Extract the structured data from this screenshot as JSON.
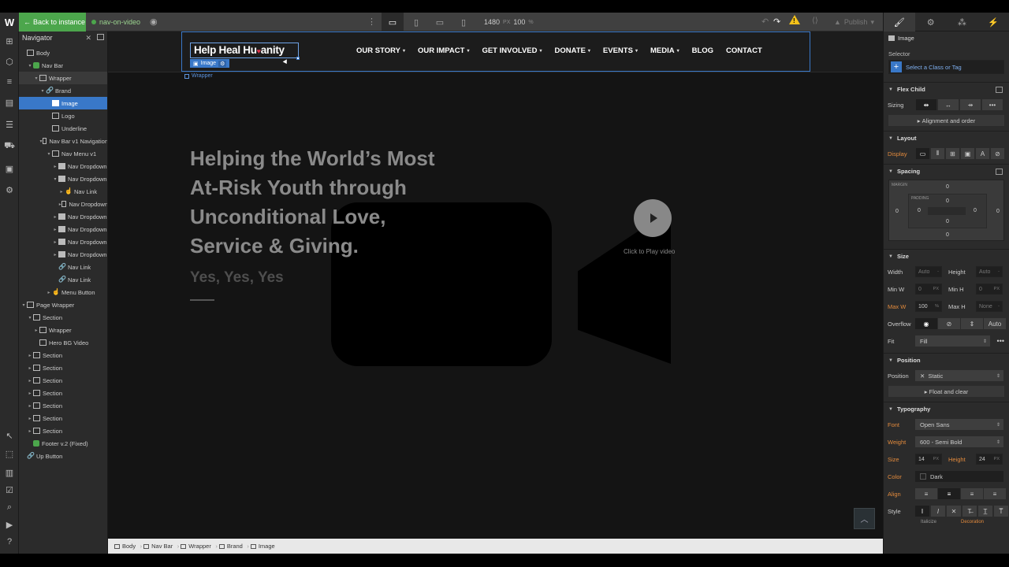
{
  "topbar": {
    "back_label": "Back to instance",
    "env_name": "nav-on-video",
    "canvas_width": "1480",
    "width_unit": "PX",
    "zoom": "100",
    "zoom_unit": "%",
    "publish_label": "Publish",
    "warning_color": "#f3c11a"
  },
  "navigator": {
    "title": "Navigator",
    "rows": [
      {
        "label": "Body",
        "depth": 0,
        "icon": "box",
        "twisty": ""
      },
      {
        "label": "Nav Bar",
        "depth": 1,
        "icon": "symbol",
        "twisty": "▾"
      },
      {
        "label": "Wrapper",
        "depth": 2,
        "icon": "box",
        "twisty": "▾",
        "state": "hover"
      },
      {
        "label": "Brand",
        "depth": 3,
        "icon": "link",
        "twisty": "▾"
      },
      {
        "label": "Image",
        "depth": 4,
        "icon": "image",
        "twisty": "",
        "state": "selected"
      },
      {
        "label": "Logo",
        "depth": 4,
        "icon": "box",
        "twisty": ""
      },
      {
        "label": "Underline",
        "depth": 4,
        "icon": "box",
        "twisty": ""
      },
      {
        "label": "Nav Bar v1 Navigation",
        "depth": 3,
        "icon": "box",
        "twisty": "▾"
      },
      {
        "label": "Nav Menu v1",
        "depth": 4,
        "icon": "box",
        "twisty": "▾"
      },
      {
        "label": "Nav Dropdown",
        "depth": 5,
        "icon": "image",
        "twisty": "▸"
      },
      {
        "label": "Nav Dropdown",
        "depth": 5,
        "icon": "image",
        "twisty": "▾"
      },
      {
        "label": "Nav Link",
        "depth": 6,
        "icon": "hand",
        "twisty": "▸"
      },
      {
        "label": "Nav Dropdown",
        "depth": 6,
        "icon": "list",
        "twisty": "▸"
      },
      {
        "label": "Nav Dropdown",
        "depth": 5,
        "icon": "image",
        "twisty": "▸"
      },
      {
        "label": "Nav Dropdown",
        "depth": 5,
        "icon": "image",
        "twisty": "▸"
      },
      {
        "label": "Nav Dropdown",
        "depth": 5,
        "icon": "image",
        "twisty": "▸"
      },
      {
        "label": "Nav Dropdown",
        "depth": 5,
        "icon": "image",
        "twisty": "▸"
      },
      {
        "label": "Nav Link",
        "depth": 5,
        "icon": "link",
        "twisty": ""
      },
      {
        "label": "Nav Link",
        "depth": 5,
        "icon": "link",
        "twisty": ""
      },
      {
        "label": "Menu Button",
        "depth": 4,
        "icon": "hand",
        "twisty": "▸"
      },
      {
        "label": "Page Wrapper",
        "depth": 0,
        "icon": "box",
        "twisty": "▾"
      },
      {
        "label": "Section",
        "depth": 1,
        "icon": "box",
        "twisty": "▾"
      },
      {
        "label": "Wrapper",
        "depth": 2,
        "icon": "box",
        "twisty": "▸"
      },
      {
        "label": "Hero BG Video",
        "depth": 2,
        "icon": "list",
        "twisty": ""
      },
      {
        "label": "Section",
        "depth": 1,
        "icon": "box",
        "twisty": "▸"
      },
      {
        "label": "Section",
        "depth": 1,
        "icon": "box",
        "twisty": "▸"
      },
      {
        "label": "Section",
        "depth": 1,
        "icon": "box",
        "twisty": "▸"
      },
      {
        "label": "Section",
        "depth": 1,
        "icon": "box",
        "twisty": "▸"
      },
      {
        "label": "Section",
        "depth": 1,
        "icon": "box",
        "twisty": "▸"
      },
      {
        "label": "Section",
        "depth": 1,
        "icon": "box",
        "twisty": "▸"
      },
      {
        "label": "Section",
        "depth": 1,
        "icon": "box",
        "twisty": "▸"
      },
      {
        "label": "Footer v.2 (Fixed)",
        "depth": 1,
        "icon": "symbol",
        "twisty": ""
      },
      {
        "label": "Up Button",
        "depth": 0,
        "icon": "link",
        "twisty": ""
      }
    ]
  },
  "site": {
    "brand": "Help Heal Humanity",
    "brand_before": "Help Heal Hu",
    "brand_after": "anity",
    "selection_tag": "Image",
    "wrapper_tag": "Wrapper",
    "menu": [
      {
        "label": "OUR STORY",
        "dropdown": true
      },
      {
        "label": "OUR IMPACT",
        "dropdown": true
      },
      {
        "label": "GET INVOLVED",
        "dropdown": true
      },
      {
        "label": "DONATE",
        "dropdown": true
      },
      {
        "label": "EVENTS",
        "dropdown": true
      },
      {
        "label": "MEDIA",
        "dropdown": true
      },
      {
        "label": "BLOG",
        "dropdown": false
      },
      {
        "label": "CONTACT",
        "dropdown": false
      }
    ],
    "hero_lines": [
      "Helping the World’s Most",
      "At-Risk Youth through",
      "Unconditional Love,",
      "Service & Giving."
    ],
    "hero_sub": "Yes, Yes, Yes",
    "play_label": "Click to Play video"
  },
  "breadcrumb": [
    "Body",
    "Nav Bar",
    "Wrapper",
    "Brand",
    "Image"
  ],
  "panel": {
    "element": "Image",
    "selector_label": "Selector",
    "selector_placeholder": "Select a Class or Tag",
    "flex_child": "Flex Child",
    "sizing_label": "Sizing",
    "alignment_order": "Alignment and order",
    "layout": "Layout",
    "display_label": "Display",
    "spacing": "Spacing",
    "margin_label": "MARGIN",
    "padding_label": "PADDING",
    "zero": "0",
    "size": "Size",
    "width_label": "Width",
    "height_label": "Height",
    "auto": "Auto",
    "dash": "-",
    "minw_label": "Min W",
    "minh_label": "Min H",
    "maxw_label": "Max W",
    "maxh_label": "Max H",
    "maxw_value": "100",
    "pct": "%",
    "px": "PX",
    "none": "None",
    "overflow_label": "Overflow",
    "fit_label": "Fit",
    "fit_value": "Fill",
    "position": "Position",
    "position_label": "Position",
    "position_value": "Static",
    "float_clear": "Float and clear",
    "typography": "Typography",
    "font_label": "Font",
    "font_value": "Open Sans",
    "weight_label": "Weight",
    "weight_value": "600 - Semi Bold",
    "size_label": "Size",
    "size_value": "14",
    "height_value": "24",
    "color_label": "Color",
    "color_value": "Dark",
    "align_label": "Align",
    "style_label": "Style",
    "italicize": "Italicize",
    "decoration": "Decoration",
    "accent_color": "#3978c8",
    "orange_label_color": "#e28a3c"
  }
}
